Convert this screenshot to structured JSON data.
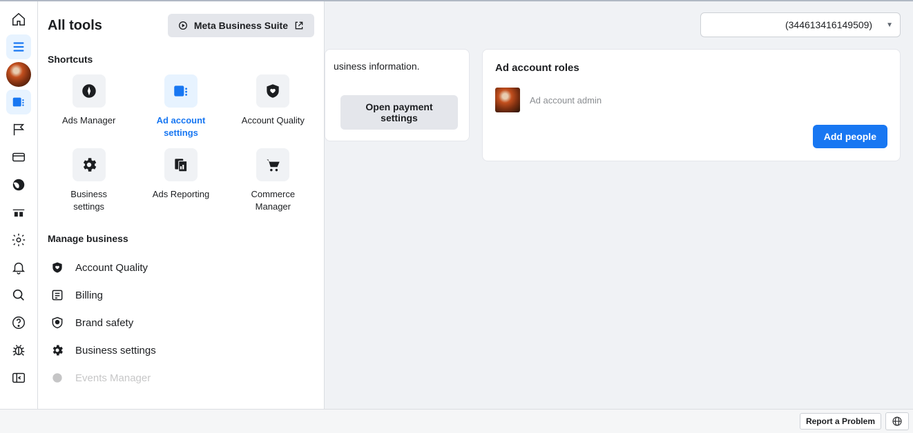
{
  "panel": {
    "title": "All tools",
    "meta_suite_label": "Meta Business Suite",
    "shortcuts_heading": "Shortcuts",
    "manage_heading": "Manage business",
    "shortcuts": [
      {
        "label": "Ads Manager",
        "icon": "compass-icon"
      },
      {
        "label": "Ad account settings",
        "icon": "card-settings-icon",
        "active": true
      },
      {
        "label": "Account Quality",
        "icon": "shield-heart-icon"
      },
      {
        "label": "Business settings",
        "icon": "gear-icon"
      },
      {
        "label": "Ads Reporting",
        "icon": "report-pages-icon"
      },
      {
        "label": "Commerce Manager",
        "icon": "shopping-cart-icon"
      }
    ],
    "manage_items": [
      {
        "label": "Account Quality",
        "icon": "shield-heart-icon"
      },
      {
        "label": "Billing",
        "icon": "invoice-icon"
      },
      {
        "label": "Brand safety",
        "icon": "shield-icon"
      },
      {
        "label": "Business settings",
        "icon": "gear-icon"
      },
      {
        "label": "Events Manager",
        "icon": "events-icon"
      }
    ]
  },
  "content": {
    "account_id_display": "(344613416149509)",
    "partial_info_text": "usiness information.",
    "open_payment_label": "Open payment settings",
    "roles_title": "Ad account roles",
    "role_label": "Ad account admin",
    "add_people_label": "Add people"
  },
  "footer": {
    "report_label": "Report a Problem"
  }
}
